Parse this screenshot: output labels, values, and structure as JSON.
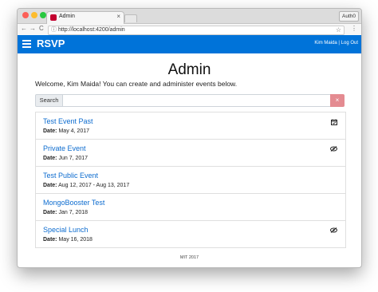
{
  "browser": {
    "tab_title": "Admin",
    "tab_close": "×",
    "profile": "Auth0",
    "url": "http://localhost:4200/admin",
    "back": "←",
    "forward": "→",
    "reload": "C",
    "info": "ⓘ",
    "star": "☆",
    "menu": "⋮"
  },
  "navbar": {
    "brand": "RSVP",
    "user": "Kim Maida | Log Out"
  },
  "main": {
    "title": "Admin",
    "welcome": "Welcome, Kim Maida! You can create and administer events below.",
    "search_label": "Search",
    "search_value": "",
    "search_clear": "×"
  },
  "events": [
    {
      "title": "Test Event Past",
      "date_label": "Date:",
      "date": "May 4, 2017",
      "icon": "calendar-check-icon"
    },
    {
      "title": "Private Event",
      "date_label": "Date:",
      "date": "Jun 7, 2017",
      "icon": "eye-slash-icon"
    },
    {
      "title": "Test Public Event",
      "date_label": "Date:",
      "date": "Aug 12, 2017 - Aug 13, 2017",
      "icon": ""
    },
    {
      "title": "MongoBooster Test",
      "date_label": "Date:",
      "date": "Jan 7, 2018",
      "icon": ""
    },
    {
      "title": "Special Lunch",
      "date_label": "Date:",
      "date": "May 16, 2018",
      "icon": "eye-slash-icon"
    }
  ],
  "footer": "MIT 2017",
  "colors": {
    "accent": "#0073d9",
    "link": "#0d6ccf",
    "danger": "#e48b91"
  }
}
